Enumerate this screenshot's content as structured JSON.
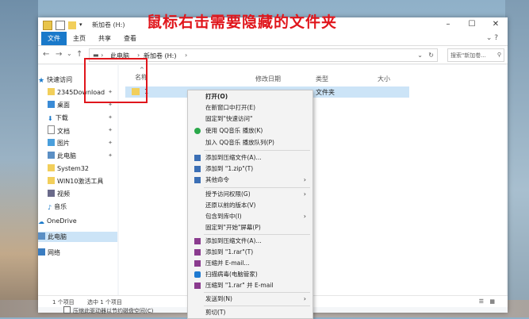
{
  "window": {
    "title": "新加卷 (H:)",
    "controls": [
      "–",
      "☐",
      "✕"
    ]
  },
  "ribbon": {
    "tabs": [
      "文件",
      "主页",
      "共享",
      "查看"
    ]
  },
  "annotation": "鼠标右击需要隐藏的文件夹",
  "address": {
    "crumbs": [
      "此电脑",
      "新加卷 (H:)"
    ],
    "search_placeholder": "搜索\"新加卷..."
  },
  "sidebar": {
    "items": [
      {
        "label": "快速访问",
        "pinned": false
      },
      {
        "label": "2345Download",
        "pinned": true
      },
      {
        "label": "桌面",
        "pinned": true
      },
      {
        "label": "下载",
        "pinned": true
      },
      {
        "label": "文档",
        "pinned": true
      },
      {
        "label": "图片",
        "pinned": true
      },
      {
        "label": "此电脑",
        "pinned": true
      },
      {
        "label": "System32",
        "pinned": false
      },
      {
        "label": "WIN10激活工具",
        "pinned": false
      },
      {
        "label": "视频",
        "pinned": false
      },
      {
        "label": "音乐",
        "pinned": false
      },
      {
        "label": "OneDrive",
        "pinned": false
      },
      {
        "label": "此电脑",
        "pinned": false
      },
      {
        "label": "网络",
        "pinned": false
      }
    ]
  },
  "columns": [
    "名称",
    "修改日期",
    "类型",
    "大小"
  ],
  "rows": [
    {
      "name": "1",
      "type": "文件夹"
    }
  ],
  "status": {
    "count": "1 个项目",
    "selected": "选中 1 个项目"
  },
  "bottom_option": "压缩此驱动器以节约磁盘空间(C)",
  "context_menu": [
    {
      "label": "打开(O)",
      "bold": true
    },
    {
      "label": "在新窗口中打开(E)"
    },
    {
      "label": "固定到\"快速访问\""
    },
    {
      "label": "使用 QQ音乐 播放(K)"
    },
    {
      "label": "加入 QQ音乐 播放队列(P)"
    },
    {
      "label": "添加到压缩文件(A)..."
    },
    {
      "label": "添加到 \"1.zip\"(T)"
    },
    {
      "label": "其他命令",
      "submenu": true
    },
    {
      "label": "授予访问权限(G)",
      "submenu": true
    },
    {
      "label": "还原以前的版本(V)"
    },
    {
      "label": "包含到库中(I)",
      "submenu": true
    },
    {
      "label": "固定到\"开始\"屏幕(P)"
    },
    {
      "label": "添加到压缩文件(A)..."
    },
    {
      "label": "添加到 \"1.rar\"(T)"
    },
    {
      "label": "压缩并 E-mail..."
    },
    {
      "label": "扫描病毒(电脑管家)"
    },
    {
      "label": "压缩到 \"1.rar\" 并 E-mail"
    },
    {
      "label": "发送到(N)",
      "submenu": true
    },
    {
      "label": "剪切(T)"
    }
  ],
  "colors": {
    "accent": "#1979ca",
    "selection": "#cce4f7",
    "annotation": "#e0161c"
  }
}
